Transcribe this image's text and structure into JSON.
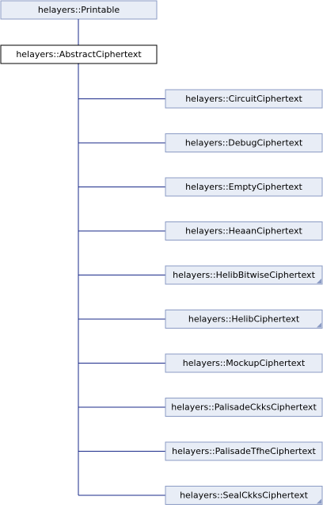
{
  "colors": {
    "node_fill": "#e8edf6",
    "node_stroke": "#8b9bc4",
    "focus_fill": "#ffffff",
    "focus_stroke": "#000000",
    "edge": "#1a2a8a"
  },
  "diagram": {
    "parent": {
      "label": "helayers::Printable"
    },
    "focus": {
      "label": "helayers::AbstractCiphertext"
    },
    "children": [
      {
        "label": "helayers::CircuitCiphertext",
        "truncated": false
      },
      {
        "label": "helayers::DebugCiphertext",
        "truncated": false
      },
      {
        "label": "helayers::EmptyCiphertext",
        "truncated": false
      },
      {
        "label": "helayers::HeaanCiphertext",
        "truncated": false
      },
      {
        "label": "helayers::HelibBitwiseCiphertext",
        "truncated": true
      },
      {
        "label": "helayers::HelibCiphertext",
        "truncated": true
      },
      {
        "label": "helayers::MockupCiphertext",
        "truncated": false
      },
      {
        "label": "helayers::PalisadeCkksCiphertext",
        "truncated": false
      },
      {
        "label": "helayers::PalisadeTfheCiphertext",
        "truncated": false
      },
      {
        "label": "helayers::SealCkksCiphertext",
        "truncated": true
      }
    ]
  }
}
